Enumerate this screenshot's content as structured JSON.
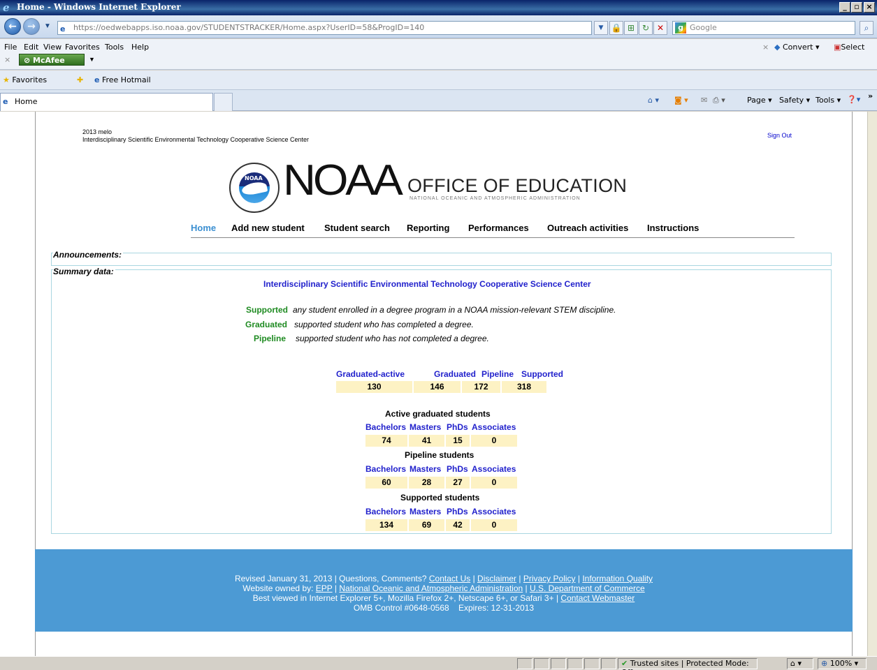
{
  "browser": {
    "window_title": "Home - Windows Internet Explorer",
    "url": "https://oedwebapps.iso.noaa.gov/STUDENTSTRACKER/Home.aspx?UserID=58&ProgID=140",
    "search_placeholder": "Google",
    "menus": [
      "File",
      "Edit",
      "View",
      "Favorites",
      "Tools",
      "Help"
    ],
    "mcafee_label": "McAfee",
    "convert_label": "Convert",
    "select_label": "Select",
    "favorites_label": "Favorites",
    "hotmail_label": "Free Hotmail",
    "tab_label": "Home",
    "cmd_page": "Page",
    "cmd_safety": "Safety",
    "cmd_tools": "Tools",
    "status_zone": "Trusted sites | Protected Mode: Off",
    "zoom": "100%"
  },
  "page": {
    "user_line": "2013 melo",
    "org_line": "Interdisciplinary Scientific Environmental Technology Cooperative Science Center",
    "sign_out": "Sign Out",
    "logo": {
      "noaa": "NOAA",
      "office": "OFFICE OF EDUCATION",
      "sub": "NATIONAL OCEANIC AND ATMOSPHERIC ADMINISTRATION",
      "emblem_text": "NOAA"
    },
    "nav": [
      "Home",
      "Add new student",
      "Student search",
      "Reporting",
      "Performances",
      "Outreach activities",
      "Instructions"
    ],
    "announcements_label": "Announcements:",
    "summary_label": "Summary data:",
    "center_title": "Interdisciplinary Scientific Environmental Technology Cooperative Science Center",
    "definitions": [
      {
        "term": "Supported",
        "text": "any student enrolled in a degree program in a NOAA mission-relevant STEM discipline."
      },
      {
        "term": "Graduated",
        "text": "supported student who has completed a degree."
      },
      {
        "term": "Pipeline",
        "text": "supported student who has not completed a degree."
      }
    ],
    "totals": {
      "headers": [
        "Graduated-active",
        "Graduated",
        "Pipeline",
        "Supported"
      ],
      "values": [
        "130",
        "146",
        "172",
        "318"
      ]
    },
    "active_graduated": {
      "title": "Active graduated students",
      "headers": [
        "Bachelors",
        "Masters",
        "PhDs",
        "Associates"
      ],
      "values": [
        "74",
        "41",
        "15",
        "0"
      ]
    },
    "pipeline": {
      "title": "Pipeline students",
      "headers": [
        "Bachelors",
        "Masters",
        "PhDs",
        "Associates"
      ],
      "values": [
        "60",
        "28",
        "27",
        "0"
      ]
    },
    "supported": {
      "title": "Supported students",
      "headers": [
        "Bachelors",
        "Masters",
        "PhDs",
        "Associates"
      ],
      "values": [
        "134",
        "69",
        "42",
        "0"
      ]
    },
    "footer": {
      "revised": "Revised January 31, 2013 | Questions, Comments?",
      "contact_us": "Contact Us",
      "disclaimer": "Disclaimer",
      "privacy": "Privacy Policy",
      "info_quality": "Information Quality",
      "owned_by": "Website owned by:",
      "epp": "EPP",
      "noaa_link": "National Oceanic and Atmospheric Administration",
      "doc_link": "U.S. Department of Commerce",
      "best_viewed": "Best viewed in Internet Explorer 5+, Mozilla Firefox 2+, Netscape 6+, or Safari 3+ |",
      "webmaster": "Contact Webmaster",
      "omb": "OMB Control #0648-0568    Expires: 12-31-2013"
    }
  }
}
